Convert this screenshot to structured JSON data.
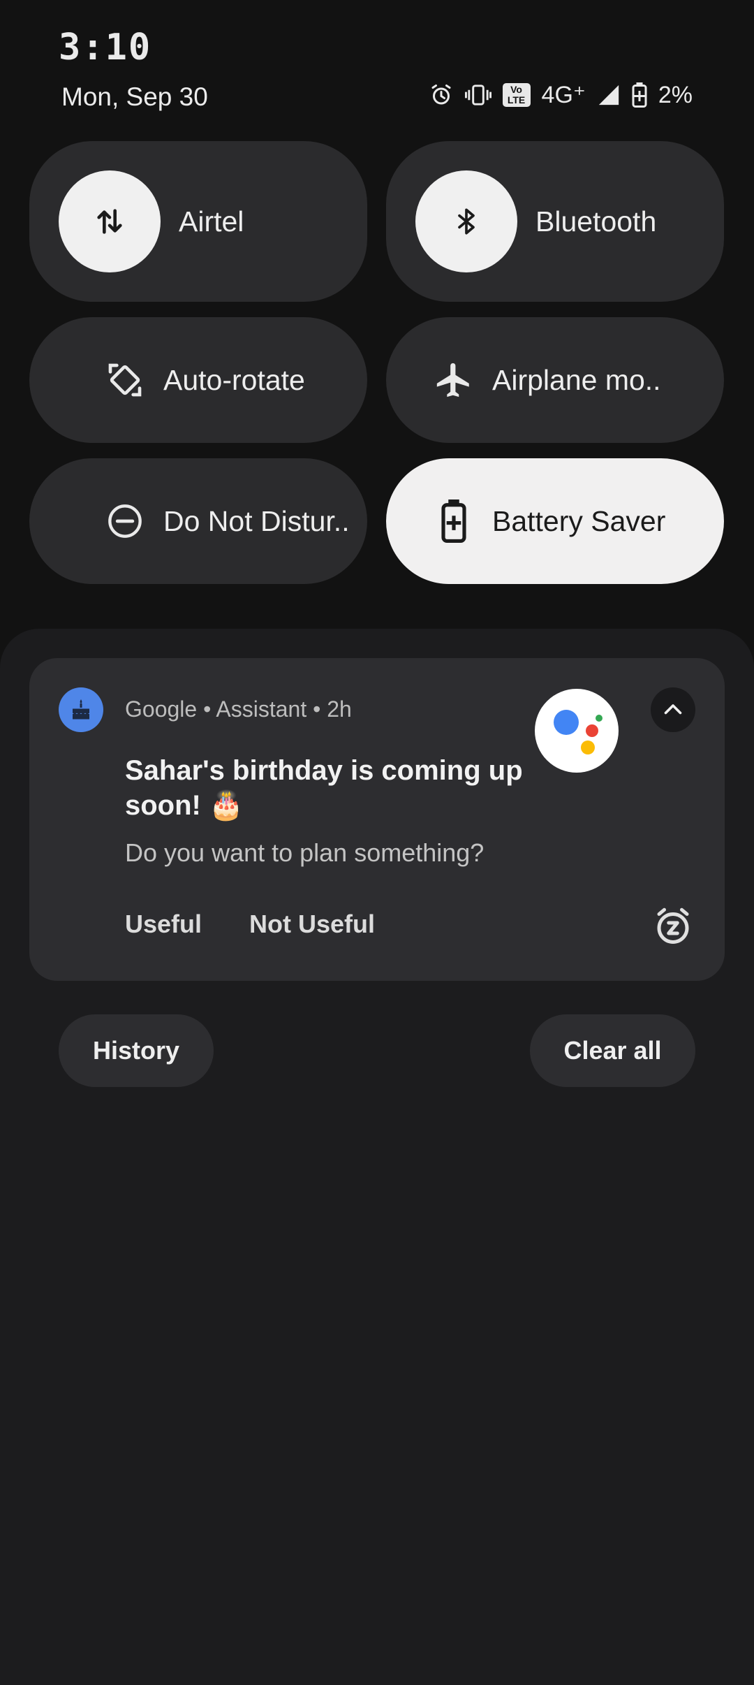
{
  "status_bar": {
    "time": "3:10",
    "date": "Mon, Sep 30",
    "network": "4G⁺",
    "volte": [
      "Vo",
      "LTE"
    ],
    "battery": "2%",
    "icons": [
      "alarm-icon",
      "vibrate-icon",
      "volte-icon",
      "signal-icon",
      "battery-icon"
    ]
  },
  "quick_settings": {
    "tiles": [
      {
        "label": "Airtel",
        "icon": "mobile-data-icon",
        "active": false
      },
      {
        "label": "Bluetooth",
        "icon": "bluetooth-icon",
        "active": false
      },
      {
        "label": "Auto-rotate",
        "icon": "auto-rotate-icon",
        "active": false
      },
      {
        "label": "Airplane mo..",
        "icon": "airplane-icon",
        "active": false
      },
      {
        "label": "Do Not Distur..",
        "icon": "do-not-disturb-icon",
        "active": false
      },
      {
        "label": "Battery Saver",
        "icon": "battery-saver-icon",
        "active": true
      }
    ]
  },
  "notification": {
    "app_line": "Google • Assistant • 2h",
    "title": "Sahar's birthday is coming up soon! 🎂",
    "body": "Do you want to plan something?",
    "actions": [
      "Useful",
      "Not Useful"
    ],
    "app_icon": "cake-icon",
    "accent": "#4f86e8"
  },
  "footer": {
    "history_label": "History",
    "clear_label": "Clear all"
  },
  "colors": {
    "background": "#121212",
    "tile": "#2b2b2d",
    "tile_active": "#f1f0f0",
    "google_blue": "#4285f4",
    "google_red": "#ea4335",
    "google_yellow": "#fbbc05",
    "google_green": "#34a853"
  }
}
